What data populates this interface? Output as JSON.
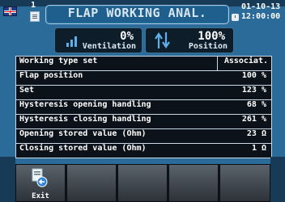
{
  "header": {
    "page_number": "1",
    "title": "FLAP WORKING ANAL.",
    "date": "01-10-13",
    "time": "12:00:00",
    "flag_icon": "uk-flag-icon",
    "page_icon": "document-icon",
    "clock_icon": "clock-icon"
  },
  "cards": {
    "ventilation": {
      "value": "0%",
      "label": "Ventilation",
      "icon": "signal-bars-icon"
    },
    "position": {
      "value": "100%",
      "label": "Position",
      "icon": "up-down-arrows-icon"
    }
  },
  "table": [
    {
      "key": "Working type set",
      "value": "Associat."
    },
    {
      "key": "Flap position",
      "value": "100 %"
    },
    {
      "key": "Set",
      "value": "123 %"
    },
    {
      "key": "Hysteresis opening handling",
      "value": "68 %"
    },
    {
      "key": "Hysteresis closing handling",
      "value": "261 %"
    },
    {
      "key": "Opening stored value (Ohm)",
      "value": "23 Ω"
    },
    {
      "key": "Closing stored value (Ohm)",
      "value": "1 Ω"
    }
  ],
  "softkeys": {
    "exit_label": "Exit",
    "exit_icon": "exit-icon"
  },
  "colors": {
    "background": "#2b6b9a",
    "panel": "#0b1219",
    "accent": "#5fb0ea"
  }
}
